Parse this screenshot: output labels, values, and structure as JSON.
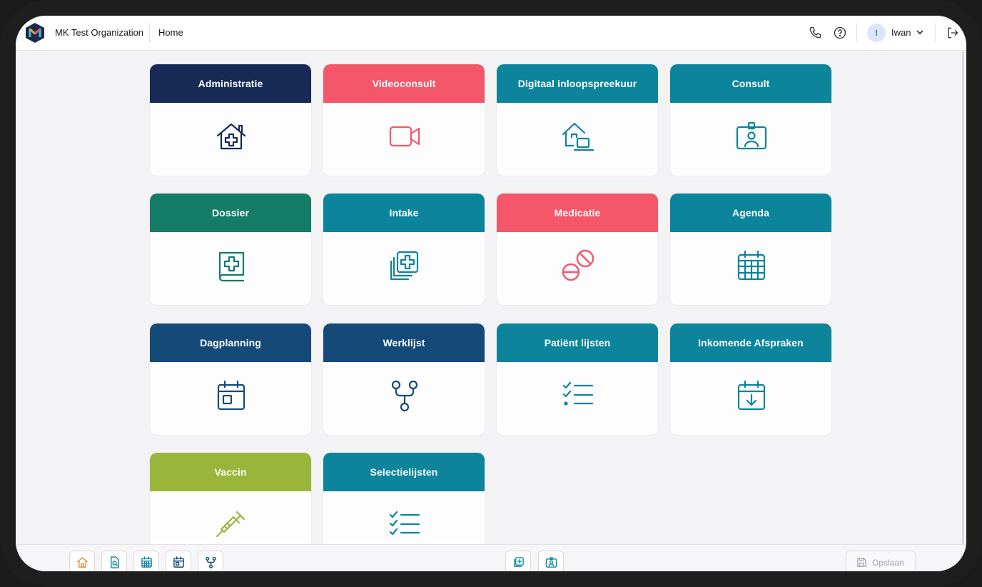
{
  "header": {
    "org_name": "MK Test Organization",
    "breadcrumb": "Home",
    "user_initial": "I",
    "user_name": "Iwan"
  },
  "tiles": [
    {
      "label": "Administratie",
      "color": "#172a55",
      "icon": "house-medical-icon"
    },
    {
      "label": "Videoconsult",
      "color": "#f4566a",
      "icon": "video-camera-icon"
    },
    {
      "label": "Digitaal inloopspreekuur",
      "color": "#0b849c",
      "icon": "house-laptop-icon"
    },
    {
      "label": "Consult",
      "color": "#0b849c",
      "icon": "id-badge-icon"
    },
    {
      "label": "Dossier",
      "color": "#157c68",
      "icon": "medical-book-icon"
    },
    {
      "label": "Intake",
      "color": "#0b849c",
      "icon": "medical-files-icon"
    },
    {
      "label": "Medicatie",
      "color": "#f4566a",
      "icon": "pills-icon"
    },
    {
      "label": "Agenda",
      "color": "#0b849c",
      "icon": "calendar-grid-icon"
    },
    {
      "label": "Dagplanning",
      "color": "#154a78",
      "icon": "calendar-day-icon"
    },
    {
      "label": "Werklijst",
      "color": "#154a78",
      "icon": "workflow-icon"
    },
    {
      "label": "Patiënt lijsten",
      "color": "#0b849c",
      "icon": "checklist-icon"
    },
    {
      "label": "Inkomende Afspraken",
      "color": "#0b849c",
      "icon": "calendar-download-icon"
    },
    {
      "label": "Vaccin",
      "color": "#9ab63a",
      "icon": "syringe-icon"
    },
    {
      "label": "Selectielijsten",
      "color": "#0b849c",
      "icon": "checklist-icon"
    }
  ],
  "bottombar": {
    "save_label": "Opslaan"
  }
}
